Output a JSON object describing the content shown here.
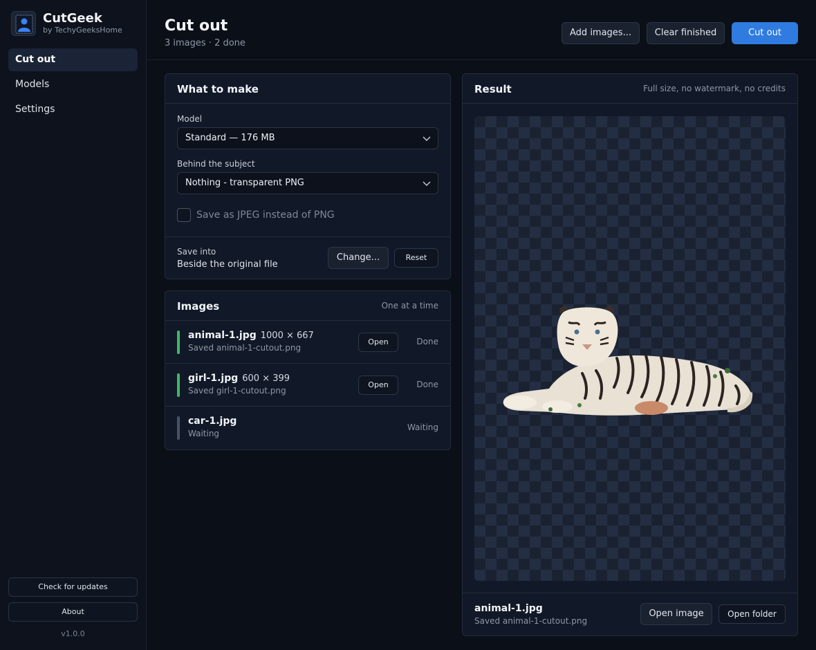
{
  "sidebar": {
    "app_name": "CutGeek",
    "app_sub": "by TechyGeeksHome",
    "nav": [
      {
        "label": "Cut out"
      },
      {
        "label": "Models"
      },
      {
        "label": "Settings"
      }
    ],
    "check_updates": "Check for updates",
    "about": "About",
    "version": "v1.0.0"
  },
  "header": {
    "title": "Cut out",
    "subtitle": "3 images · 2 done",
    "add_images": "Add images...",
    "clear_finished": "Clear finished",
    "cut_out": "Cut out"
  },
  "what_to_make": {
    "title": "What to make",
    "model_label": "Model",
    "model_value": "Standard — 176 MB",
    "behind_label": "Behind the subject",
    "behind_value": "Nothing - transparent PNG",
    "jpeg_label": "Save as JPEG instead of PNG",
    "jpeg_checked": false,
    "save_into_label": "Save into",
    "save_into_value": "Beside the original file",
    "change": "Change...",
    "reset": "Reset"
  },
  "images": {
    "title": "Images",
    "note": "One at a time",
    "rows": [
      {
        "name": "animal-1.jpg",
        "dims": "1000 × 667",
        "sub": "Saved animal-1-cutout.png",
        "open": "Open",
        "status": "Done",
        "color": "#3fb965"
      },
      {
        "name": "girl-1.jpg",
        "dims": "600 × 399",
        "sub": "Saved girl-1-cutout.png",
        "open": "Open",
        "status": "Done",
        "color": "#3fb965"
      },
      {
        "name": "car-1.jpg",
        "dims": "",
        "sub": "Waiting",
        "status": "Waiting",
        "color": "#4a5366"
      }
    ]
  },
  "result": {
    "title": "Result",
    "note": "Full size, no watermark, no credits",
    "file_name": "animal-1.jpg",
    "file_sub": "Saved animal-1-cutout.png",
    "open_image": "Open image",
    "open_folder": "Open folder"
  }
}
